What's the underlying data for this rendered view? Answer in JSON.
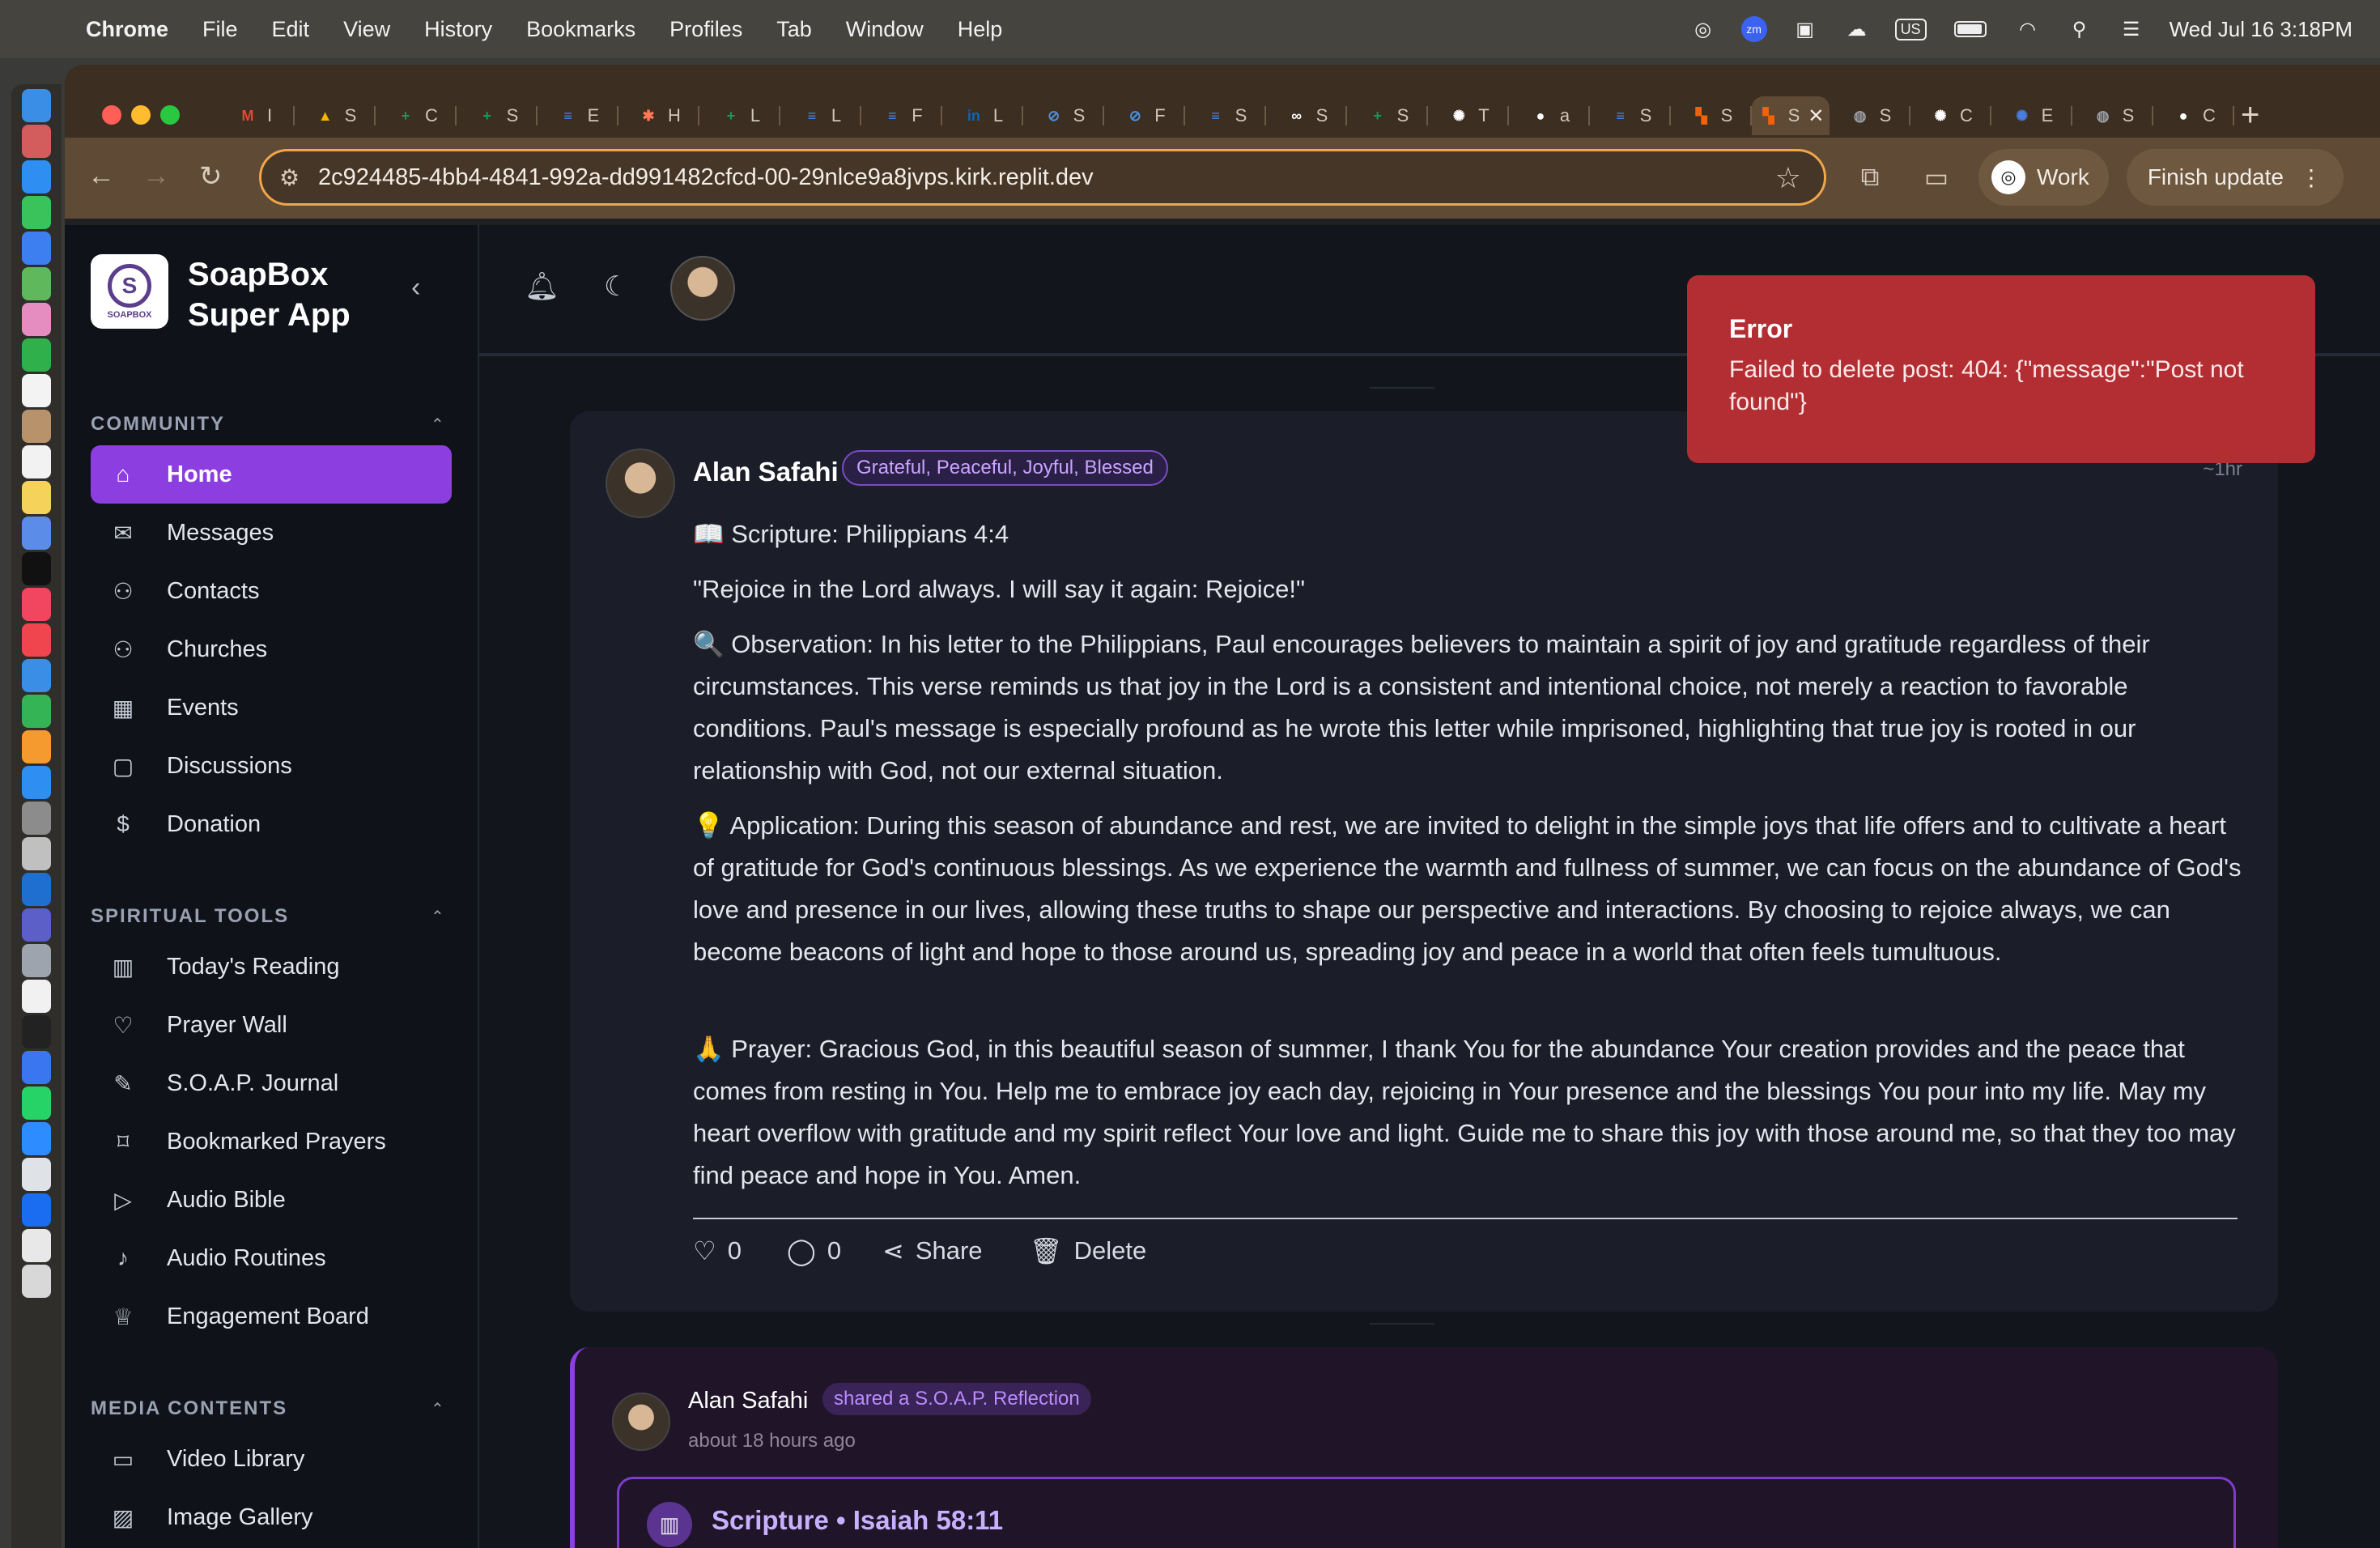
{
  "menubar": {
    "app": "Chrome",
    "items": [
      "File",
      "Edit",
      "View",
      "History",
      "Bookmarks",
      "Profiles",
      "Tab",
      "Window",
      "Help"
    ],
    "zoom_label": "zm",
    "input_source": "US",
    "datetime": "Wed Jul 16  3:18PM"
  },
  "browser": {
    "tabs": [
      {
        "icon": "gmail-icon",
        "color": "#ea4335",
        "glyph": "M",
        "label": "I"
      },
      {
        "icon": "drive-icon",
        "color": "#f4b400",
        "glyph": "▲",
        "label": "S"
      },
      {
        "icon": "sheets-icon",
        "color": "#0f9d58",
        "glyph": "+",
        "label": "C"
      },
      {
        "icon": "sheets-icon",
        "color": "#0f9d58",
        "glyph": "+",
        "label": "S"
      },
      {
        "icon": "docs-icon",
        "color": "#4285f4",
        "glyph": "≡",
        "label": "E"
      },
      {
        "icon": "hubspot-icon",
        "color": "#ff7a59",
        "glyph": "✱",
        "label": "H"
      },
      {
        "icon": "sheets-icon",
        "color": "#0f9d58",
        "glyph": "+",
        "label": "L"
      },
      {
        "icon": "docs-icon",
        "color": "#4285f4",
        "glyph": "≡",
        "label": "L"
      },
      {
        "icon": "docs-icon",
        "color": "#4285f4",
        "glyph": "≡",
        "label": "F"
      },
      {
        "icon": "linkedin-icon",
        "color": "#0a66c2",
        "glyph": "in",
        "label": "L"
      },
      {
        "icon": "compass-icon",
        "color": "#4a90e2",
        "glyph": "⊘",
        "label": "S"
      },
      {
        "icon": "compass-icon",
        "color": "#4a90e2",
        "glyph": "⊘",
        "label": "F"
      },
      {
        "icon": "docs-icon",
        "color": "#4285f4",
        "glyph": "≡",
        "label": "S"
      },
      {
        "icon": "link-icon",
        "color": "#ffffff",
        "glyph": "∞",
        "label": "S"
      },
      {
        "icon": "sheets-icon",
        "color": "#0f9d58",
        "glyph": "+",
        "label": "S"
      },
      {
        "icon": "openai-icon",
        "color": "#ffffff",
        "glyph": "✺",
        "label": "T"
      },
      {
        "icon": "github-icon",
        "color": "#ffffff",
        "glyph": "●",
        "label": "a"
      },
      {
        "icon": "docs-icon",
        "color": "#4285f4",
        "glyph": "≡",
        "label": "S"
      },
      {
        "icon": "replit-icon",
        "color": "#f26207",
        "glyph": "▚",
        "label": "S"
      },
      {
        "icon": "replit-icon",
        "color": "#f26207",
        "glyph": "▚",
        "label": "S",
        "active": true
      },
      {
        "icon": "globe-icon",
        "color": "#9aa0a6",
        "glyph": "◍",
        "label": "S"
      },
      {
        "icon": "openai-icon",
        "color": "#ffffff",
        "glyph": "✺",
        "label": "C"
      },
      {
        "icon": "openai-icon",
        "color": "#4a7de0",
        "glyph": "✺",
        "label": "E"
      },
      {
        "icon": "globe-icon",
        "color": "#9aa0a6",
        "glyph": "◍",
        "label": "S"
      },
      {
        "icon": "github-icon",
        "color": "#ffffff",
        "glyph": "●",
        "label": "C"
      }
    ],
    "url": "2c924485-4bb4-4841-992a-dd991482cfcd-00-29nlce9a8jvps.kirk.replit.dev",
    "profile_label": "Work",
    "finish_update_label": "Finish update"
  },
  "app": {
    "name": "SoapBox Super App",
    "logo_glyph": "S",
    "logo_text": "SOAPBOX"
  },
  "sidebar": {
    "sections": [
      {
        "title": "COMMUNITY",
        "items": [
          {
            "label": "Home",
            "icon": "home-icon",
            "glyph": "⌂",
            "active": true
          },
          {
            "label": "Messages",
            "icon": "mail-icon",
            "glyph": "✉"
          },
          {
            "label": "Contacts",
            "icon": "user-plus-icon",
            "glyph": "⚇"
          },
          {
            "label": "Churches",
            "icon": "users-icon",
            "glyph": "⚇"
          },
          {
            "label": "Events",
            "icon": "calendar-icon",
            "glyph": "▦"
          },
          {
            "label": "Discussions",
            "icon": "chat-icon",
            "glyph": "▢"
          },
          {
            "label": "Donation",
            "icon": "dollar-icon",
            "glyph": "$"
          }
        ]
      },
      {
        "title": "SPIRITUAL TOOLS",
        "items": [
          {
            "label": "Today's Reading",
            "icon": "book-icon",
            "glyph": "▥"
          },
          {
            "label": "Prayer Wall",
            "icon": "heart-icon",
            "glyph": "♡"
          },
          {
            "label": "S.O.A.P. Journal",
            "icon": "pen-icon",
            "glyph": "✎"
          },
          {
            "label": "Bookmarked Prayers",
            "icon": "bookmark-icon",
            "glyph": "⌑"
          },
          {
            "label": "Audio Bible",
            "icon": "play-icon",
            "glyph": "▷"
          },
          {
            "label": "Audio Routines",
            "icon": "mic-icon",
            "glyph": "♪"
          },
          {
            "label": "Engagement Board",
            "icon": "trophy-icon",
            "glyph": "♕"
          }
        ]
      },
      {
        "title": "MEDIA CONTENTS",
        "items": [
          {
            "label": "Video Library",
            "icon": "video-icon",
            "glyph": "▭"
          },
          {
            "label": "Image Gallery",
            "icon": "image-icon",
            "glyph": "▨"
          }
        ]
      }
    ]
  },
  "post1": {
    "author": "Alan Safahi",
    "mood": "Grateful, Peaceful, Joyful, Blessed",
    "time": "~1hr",
    "scripture": "📖 Scripture: Philippians 4:4",
    "quote": "\"Rejoice in the Lord always. I will say it again: Rejoice!\"",
    "observation": "🔍 Observation: In his letter to the Philippians, Paul encourages believers to maintain a spirit of joy and gratitude regardless of their circumstances. This verse reminds us that joy in the Lord is a consistent and intentional choice, not merely a reaction to favorable conditions. Paul's message is especially profound as he wrote this letter while imprisoned, highlighting that true joy is rooted in our relationship with God, not our external situation.",
    "application": "💡 Application: During this season of abundance and rest, we are invited to delight in the simple joys that life offers and to cultivate a heart of gratitude for God's continuous blessings. As we experience the warmth and fullness of summer, we can focus on the abundance of God's love and presence in our lives, allowing these truths to shape our perspective and interactions. By choosing to rejoice always, we can become beacons of light and hope to those around us, spreading joy and peace in a world that often feels tumultuous.",
    "prayer": "🙏 Prayer: Gracious God, in this beautiful season of summer, I thank You for the abundance Your creation provides and the peace that comes from resting in You. Help me to embrace joy each day, rejoicing in Your presence and the blessings You pour into my life. May my heart overflow with gratitude and my spirit reflect Your love and light. Guide me to share this joy with those around me, so that they too may find peace and hope in You. Amen.",
    "likes": "0",
    "comments": "0",
    "share_label": "Share",
    "delete_label": "Delete"
  },
  "post2": {
    "author": "Alan Safahi",
    "badge": "shared a S.O.A.P. Reflection",
    "time": "about 18 hours ago",
    "scripture": "Scripture • Isaiah 58:11"
  },
  "toast": {
    "title": "Error",
    "message": "Failed to delete post: 404: {\"message\":\"Post not found\"}"
  }
}
